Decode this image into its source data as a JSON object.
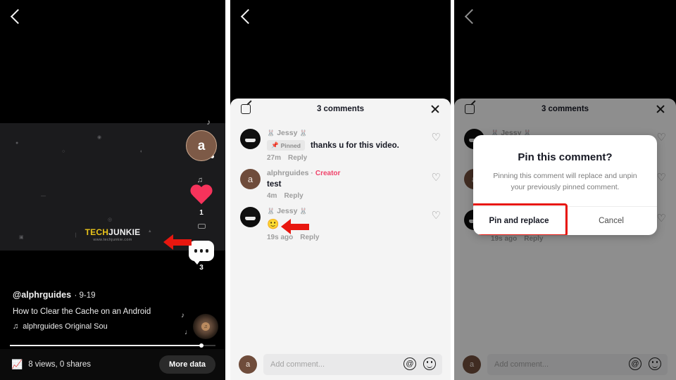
{
  "app": {
    "name": "TikTok",
    "brand_red": "#f0426a",
    "highlight_red": "#e8170f",
    "sheet_bg": "#f4f4f4"
  },
  "panel1": {
    "back_icon": "back-chevron-icon",
    "watermark": {
      "line1_a": "TECH",
      "line1_b": "JUNKIE",
      "line2": "www.techjunkie.com"
    },
    "rail": {
      "avatar_letter": "a",
      "like_count": "1",
      "comment_count": "3",
      "more_icon": "more-horizontal-icon"
    },
    "caption": {
      "username": "@alphrguides",
      "date": "9-19",
      "title": "How to Clear the Cache on an Android",
      "music_note_icon": "music-note-icon",
      "music": "alphrguides Original Sou"
    },
    "stats": {
      "chart_icon": "analytics-icon",
      "text": "8 views, 0 shares",
      "more_data_label": "More data"
    }
  },
  "panel2": {
    "back_icon": "back-chevron-icon",
    "sheet": {
      "edit_icon": "compose-icon",
      "title": "3 comments",
      "close_icon": "close-icon"
    },
    "comments": [
      {
        "avatar_type": "dark",
        "name": "Jessy",
        "name_prefix": "🐰",
        "name_suffix": "🐰",
        "pinned_badge": "Pinned",
        "pin_icon": "pin-icon",
        "text": "thanks u for this video.",
        "time": "27m",
        "reply_label": "Reply",
        "like_icon": "heart-outline-icon"
      },
      {
        "avatar_type": "brown",
        "avatar_letter": "a",
        "name": "alphrguides",
        "separator": "·",
        "badge": "Creator",
        "text": "test",
        "time": "4m",
        "reply_label": "Reply",
        "like_icon": "heart-outline-icon"
      },
      {
        "avatar_type": "dark",
        "name": "Jessy",
        "name_prefix": "🐰",
        "name_suffix": "🐰",
        "text": "🙂",
        "time": "19s ago",
        "reply_label": "Reply",
        "like_icon": "heart-outline-icon"
      }
    ],
    "input": {
      "avatar_letter": "a",
      "placeholder": "Add comment...",
      "at_icon": "at-mention-icon",
      "emoji_icon": "emoji-icon"
    }
  },
  "panel3": {
    "back_icon": "back-chevron-icon",
    "sheet": {
      "edit_icon": "compose-icon",
      "title": "3 comments",
      "close_icon": "close-icon"
    },
    "comments": [
      {
        "avatar_type": "dark",
        "name": "Jessy",
        "name_prefix": "🐰",
        "name_suffix": "🐰",
        "like_icon": "heart-outline-icon"
      },
      {
        "avatar_type": "brown",
        "avatar_letter": "a",
        "like_icon": "heart-outline-icon"
      },
      {
        "avatar_type": "dark",
        "time": "19s ago",
        "reply_label": "Reply",
        "like_icon": "heart-outline-icon"
      }
    ],
    "dialog": {
      "title": "Pin this comment?",
      "message": "Pinning this comment will replace and unpin your previously pinned comment.",
      "confirm_label": "Pin and replace",
      "cancel_label": "Cancel"
    },
    "input": {
      "avatar_letter": "a",
      "placeholder": "Add comment...",
      "at_icon": "at-mention-icon",
      "emoji_icon": "emoji-icon"
    }
  }
}
